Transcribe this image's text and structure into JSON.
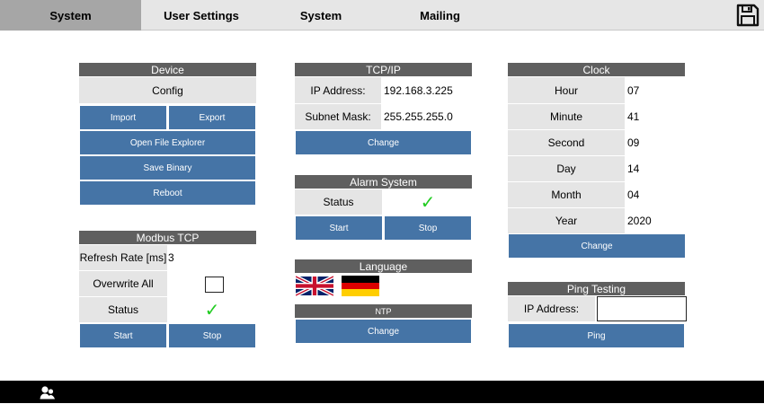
{
  "tabs": [
    {
      "label": "System"
    },
    {
      "label": "User Settings"
    },
    {
      "label": "System"
    },
    {
      "label": "Mailing"
    }
  ],
  "device": {
    "header": "Device",
    "config_label": "Config",
    "import_label": "Import",
    "export_label": "Export",
    "open_file_explorer_label": "Open File Explorer",
    "save_binary_label": "Save Binary",
    "reboot_label": "Reboot"
  },
  "modbus": {
    "header": "Modbus TCP",
    "refresh_rate_label": "Refresh Rate [ms]",
    "refresh_rate_value": "3",
    "overwrite_all_label": "Overwrite All",
    "status_label": "Status",
    "status_check": "✓",
    "start_label": "Start",
    "stop_label": "Stop"
  },
  "tcpip": {
    "header": "TCP/IP",
    "ip_label": "IP Address:",
    "ip_value": "192.168.3.225",
    "mask_label": "Subnet Mask:",
    "mask_value": "255.255.255.0",
    "change_label": "Change"
  },
  "alarm": {
    "header": "Alarm System",
    "status_label": "Status",
    "status_check": "✓",
    "start_label": "Start",
    "stop_label": "Stop"
  },
  "language": {
    "header": "Language",
    "flags": [
      "uk-flag-icon",
      "germany-flag-icon"
    ]
  },
  "ntp": {
    "header": "NTP",
    "change_label": "Change"
  },
  "clock": {
    "header": "Clock",
    "rows": [
      {
        "label": "Hour",
        "value": "07"
      },
      {
        "label": "Minute",
        "value": "41"
      },
      {
        "label": "Second",
        "value": "09"
      },
      {
        "label": "Day",
        "value": "14"
      },
      {
        "label": "Month",
        "value": "04"
      },
      {
        "label": "Year",
        "value": "2020"
      }
    ],
    "change_label": "Change"
  },
  "ping": {
    "header": "Ping Testing",
    "ip_label": "IP Address:",
    "ip_value": "",
    "ping_label": "Ping"
  },
  "icons": {
    "save": "save-icon",
    "user": "user-icon"
  },
  "colors": {
    "button_blue": "#4574a6",
    "header_gray": "#5f5f5f",
    "label_gray": "#e5e5e5",
    "active_tab": "#a6a6a6",
    "check_green": "#22cc22"
  }
}
